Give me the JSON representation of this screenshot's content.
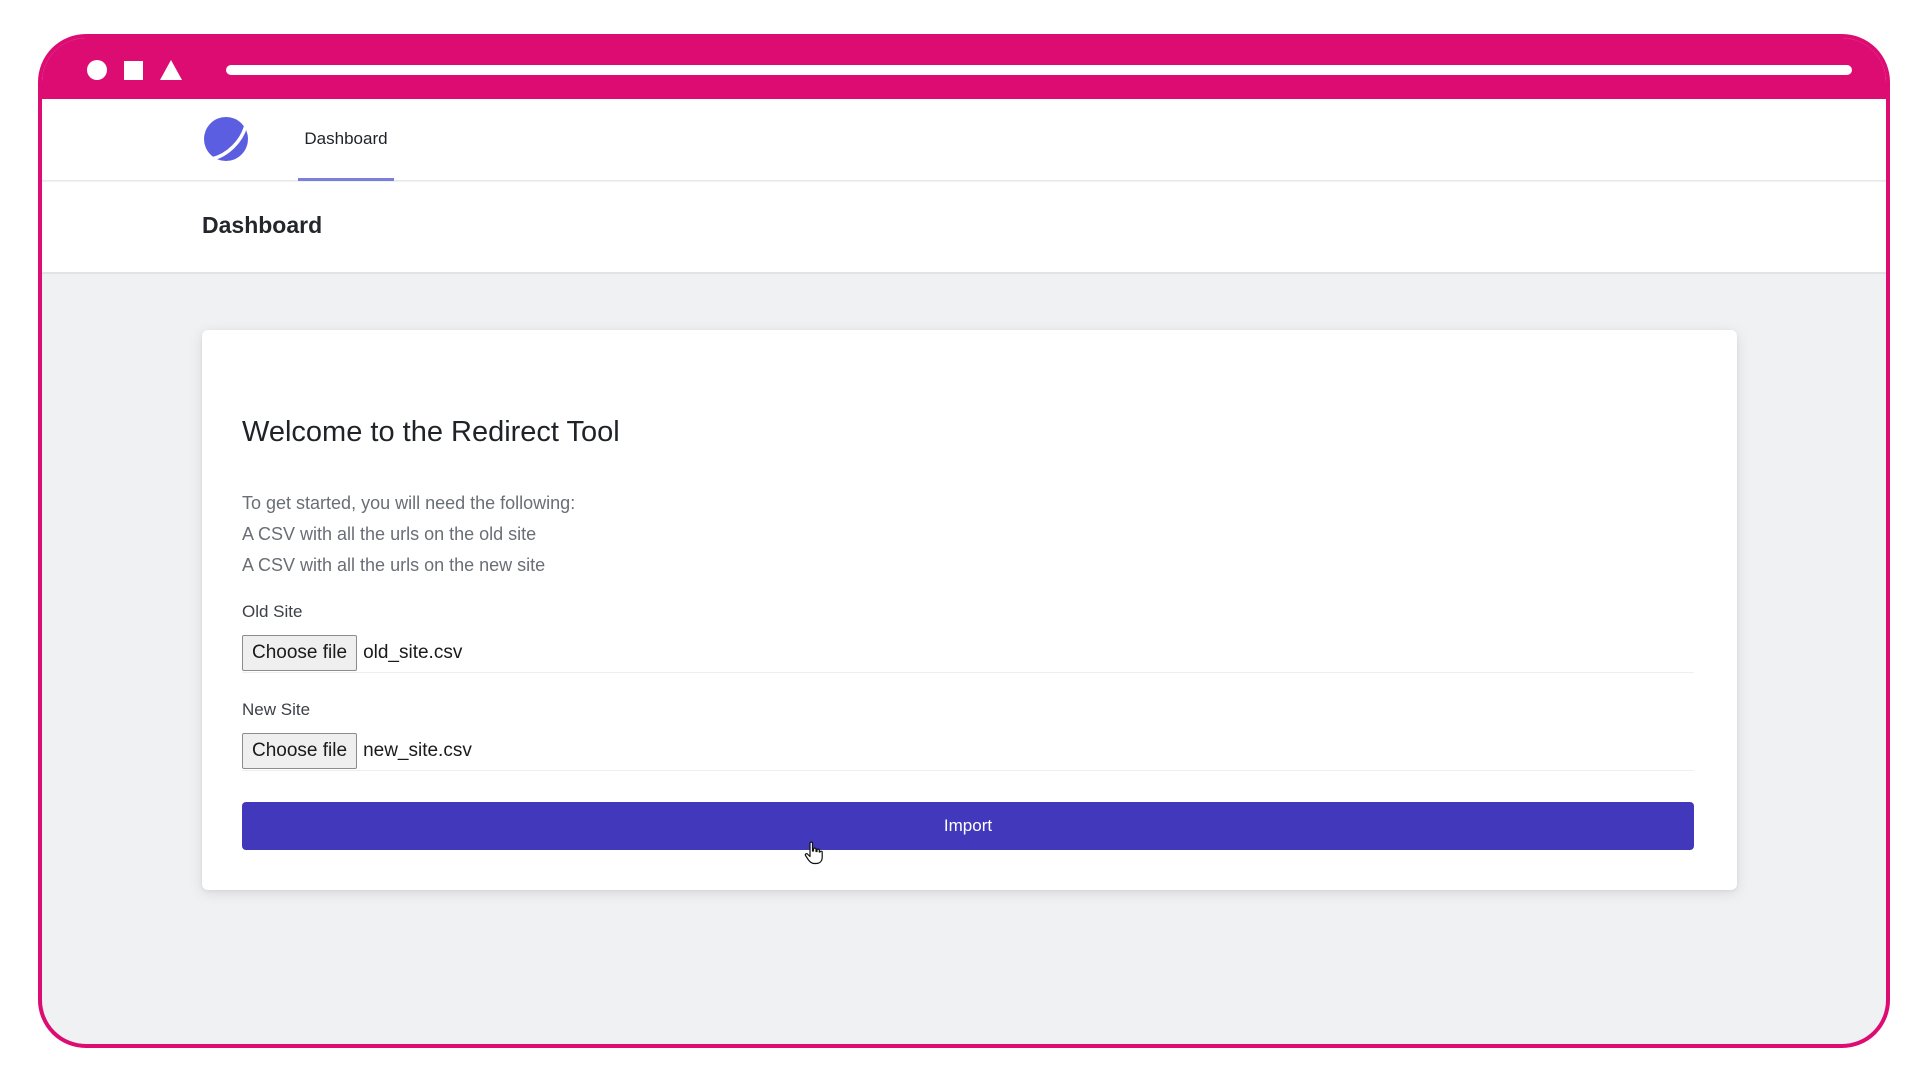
{
  "nav": {
    "logo_icon": "planet-logo-icon",
    "tabs": [
      {
        "label": "Dashboard",
        "active": true
      }
    ]
  },
  "header": {
    "title": "Dashboard"
  },
  "card": {
    "title": "Welcome to the Redirect Tool",
    "intro_lines": [
      "To get started, you will need the following:",
      "A CSV with all the urls on the old site",
      "A CSV with all the urls on the new site"
    ],
    "old_site": {
      "label": "Old Site",
      "button_label": "Choose file",
      "file_name": "old_site.csv"
    },
    "new_site": {
      "label": "New Site",
      "button_label": "Choose file",
      "file_name": "new_site.csv"
    },
    "import_label": "Import"
  },
  "colors": {
    "frame": "#dd0c73",
    "accent": "#4138bc",
    "logo": "#5b5ee0",
    "tab_underline": "#7b7fdc",
    "background": "#f0f1f3"
  }
}
